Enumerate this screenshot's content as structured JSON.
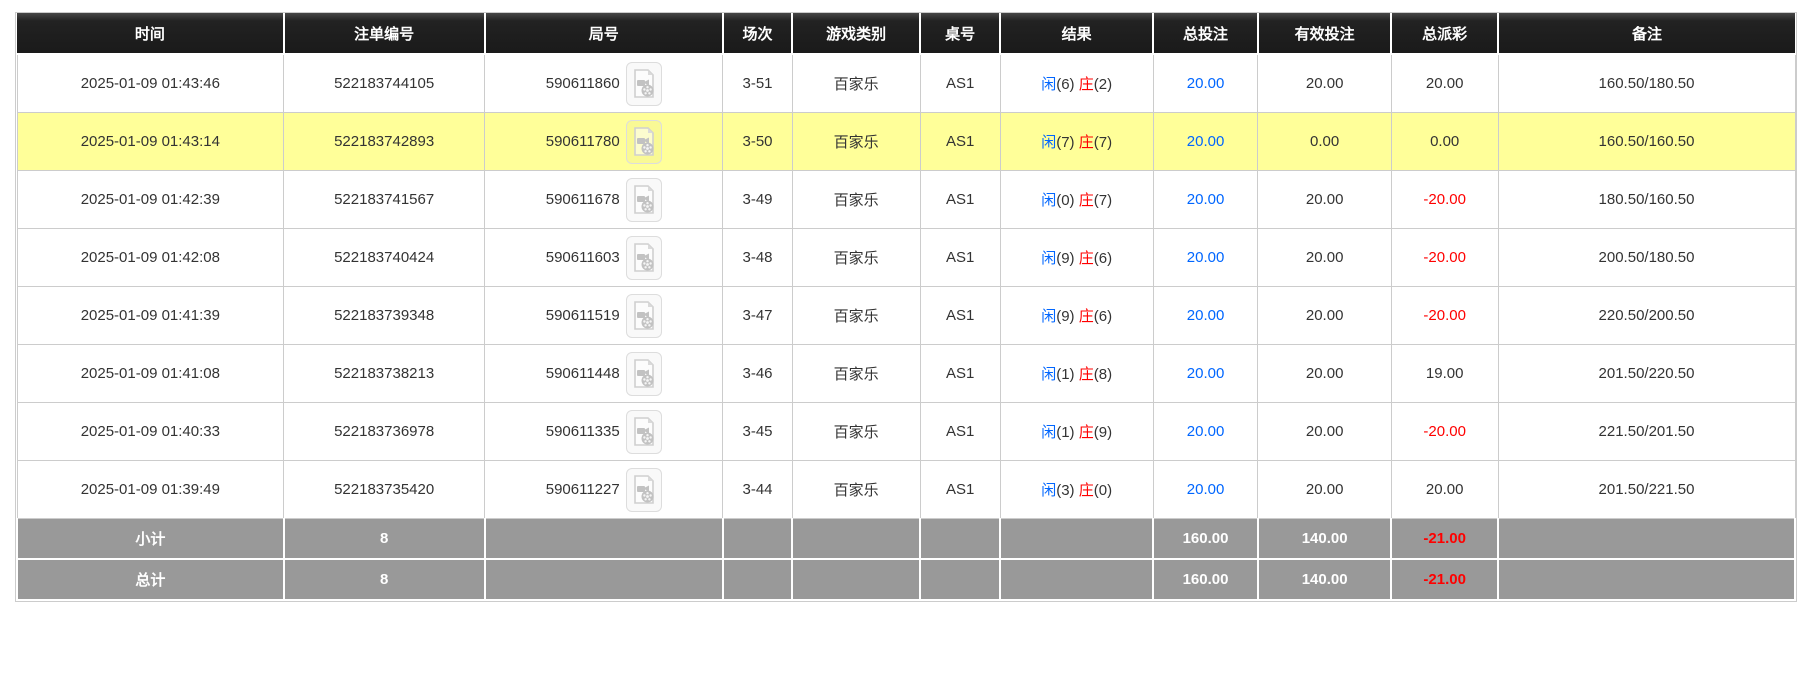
{
  "table": {
    "columns": [
      {
        "key": "time",
        "label": "时间"
      },
      {
        "key": "bet_id",
        "label": "注单编号"
      },
      {
        "key": "round_id",
        "label": "局号"
      },
      {
        "key": "session",
        "label": "场次"
      },
      {
        "key": "game_type",
        "label": "游戏类别"
      },
      {
        "key": "table_no",
        "label": "桌号"
      },
      {
        "key": "result",
        "label": "结果"
      },
      {
        "key": "total_bet",
        "label": "总投注"
      },
      {
        "key": "valid_bet",
        "label": "有效投注"
      },
      {
        "key": "payout",
        "label": "总派彩"
      },
      {
        "key": "remark",
        "label": "备注"
      }
    ],
    "rows": [
      {
        "time": "2025-01-09 01:43:46",
        "bet_id": "522183744105",
        "round_id": "590611860",
        "session": "3-51",
        "game_type": "百家乐",
        "table_no": "AS1",
        "result": {
          "player_label": "闲",
          "player_score": "(6)",
          "banker_label": "庄",
          "banker_score": "(2)"
        },
        "total_bet": "20.00",
        "valid_bet": "20.00",
        "payout": "20.00",
        "remark": "160.50/180.50",
        "highlighted": false
      },
      {
        "time": "2025-01-09 01:43:14",
        "bet_id": "522183742893",
        "round_id": "590611780",
        "session": "3-50",
        "game_type": "百家乐",
        "table_no": "AS1",
        "result": {
          "player_label": "闲",
          "player_score": "(7)",
          "banker_label": "庄",
          "banker_score": "(7)"
        },
        "total_bet": "20.00",
        "valid_bet": "0.00",
        "payout": "0.00",
        "remark": "160.50/160.50",
        "highlighted": true
      },
      {
        "time": "2025-01-09 01:42:39",
        "bet_id": "522183741567",
        "round_id": "590611678",
        "session": "3-49",
        "game_type": "百家乐",
        "table_no": "AS1",
        "result": {
          "player_label": "闲",
          "player_score": "(0)",
          "banker_label": "庄",
          "banker_score": "(7)"
        },
        "total_bet": "20.00",
        "valid_bet": "20.00",
        "payout": "-20.00",
        "remark": "180.50/160.50",
        "highlighted": false
      },
      {
        "time": "2025-01-09 01:42:08",
        "bet_id": "522183740424",
        "round_id": "590611603",
        "session": "3-48",
        "game_type": "百家乐",
        "table_no": "AS1",
        "result": {
          "player_label": "闲",
          "player_score": "(9)",
          "banker_label": "庄",
          "banker_score": "(6)"
        },
        "total_bet": "20.00",
        "valid_bet": "20.00",
        "payout": "-20.00",
        "remark": "200.50/180.50",
        "highlighted": false
      },
      {
        "time": "2025-01-09 01:41:39",
        "bet_id": "522183739348",
        "round_id": "590611519",
        "session": "3-47",
        "game_type": "百家乐",
        "table_no": "AS1",
        "result": {
          "player_label": "闲",
          "player_score": "(9)",
          "banker_label": "庄",
          "banker_score": "(6)"
        },
        "total_bet": "20.00",
        "valid_bet": "20.00",
        "payout": "-20.00",
        "remark": "220.50/200.50",
        "highlighted": false
      },
      {
        "time": "2025-01-09 01:41:08",
        "bet_id": "522183738213",
        "round_id": "590611448",
        "session": "3-46",
        "game_type": "百家乐",
        "table_no": "AS1",
        "result": {
          "player_label": "闲",
          "player_score": "(1)",
          "banker_label": "庄",
          "banker_score": "(8)"
        },
        "total_bet": "20.00",
        "valid_bet": "20.00",
        "payout": "19.00",
        "remark": "201.50/220.50",
        "highlighted": false
      },
      {
        "time": "2025-01-09 01:40:33",
        "bet_id": "522183736978",
        "round_id": "590611335",
        "session": "3-45",
        "game_type": "百家乐",
        "table_no": "AS1",
        "result": {
          "player_label": "闲",
          "player_score": "(1)",
          "banker_label": "庄",
          "banker_score": "(9)"
        },
        "total_bet": "20.00",
        "valid_bet": "20.00",
        "payout": "-20.00",
        "remark": "221.50/201.50",
        "highlighted": false
      },
      {
        "time": "2025-01-09 01:39:49",
        "bet_id": "522183735420",
        "round_id": "590611227",
        "session": "3-44",
        "game_type": "百家乐",
        "table_no": "AS1",
        "result": {
          "player_label": "闲",
          "player_score": "(3)",
          "banker_label": "庄",
          "banker_score": "(0)"
        },
        "total_bet": "20.00",
        "valid_bet": "20.00",
        "payout": "20.00",
        "remark": "201.50/221.50",
        "highlighted": false
      }
    ],
    "footer": [
      {
        "label": "小计",
        "count": "8",
        "total_bet": "160.00",
        "valid_bet": "140.00",
        "payout": "-21.00"
      },
      {
        "label": "总计",
        "count": "8",
        "total_bet": "160.00",
        "valid_bet": "140.00",
        "payout": "-21.00"
      }
    ]
  },
  "icons": {
    "video_replay": "video-file-icon"
  },
  "colors": {
    "header_bg": "#1a1a1a",
    "header_text": "#ffffff",
    "highlight_row_bg": "#ffff99",
    "footer_bg": "#999999",
    "footer_text": "#ffffff",
    "player_blue": "#0066ff",
    "banker_red": "#ff0000",
    "bet_link_blue": "#0066ff",
    "negative_red": "#ff0000",
    "grid_border": "#cccccc"
  }
}
